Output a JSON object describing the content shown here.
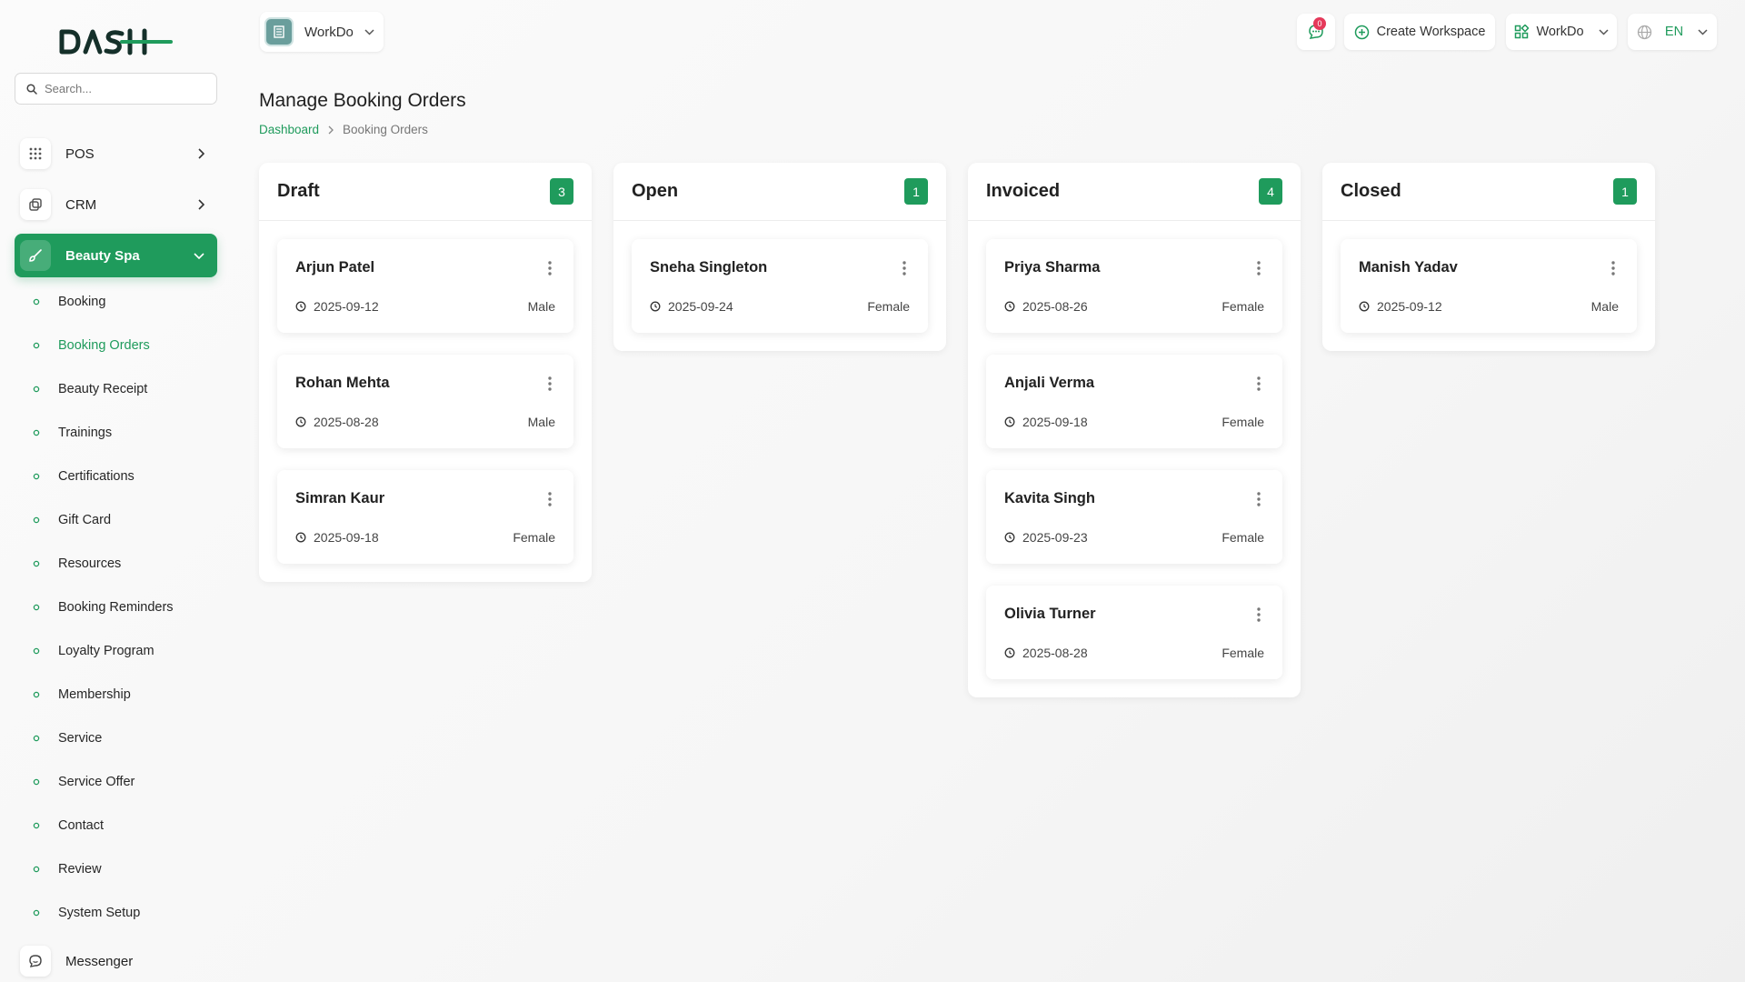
{
  "brand": {
    "logo_text": "DASH",
    "accent": "#1f9b5c"
  },
  "search": {
    "placeholder": "Search..."
  },
  "sidebar": {
    "menu": [
      {
        "label": "POS",
        "icon": "grid-icon"
      },
      {
        "label": "CRM",
        "icon": "layers-icon"
      },
      {
        "label": "Beauty Spa",
        "icon": "brush-icon",
        "active": true
      }
    ],
    "sub_items": [
      {
        "label": "Booking"
      },
      {
        "label": "Booking Orders",
        "active": true
      },
      {
        "label": "Beauty Receipt"
      },
      {
        "label": "Trainings"
      },
      {
        "label": "Certifications"
      },
      {
        "label": "Gift Card"
      },
      {
        "label": "Resources"
      },
      {
        "label": "Booking Reminders"
      },
      {
        "label": "Loyalty Program"
      },
      {
        "label": "Membership"
      },
      {
        "label": "Service"
      },
      {
        "label": "Service Offer"
      },
      {
        "label": "Contact"
      },
      {
        "label": "Review"
      },
      {
        "label": "System Setup"
      }
    ],
    "messenger": "Messenger"
  },
  "topbar": {
    "workspace_label": "WorkDo",
    "notification_count": "0",
    "create_workspace": "Create Workspace",
    "workspace_menu": "WorkDo",
    "language": "EN"
  },
  "page": {
    "title": "Manage Booking Orders",
    "breadcrumb_home": "Dashboard",
    "breadcrumb_current": "Booking Orders"
  },
  "columns": [
    {
      "title": "Draft",
      "count": "3",
      "cards": [
        {
          "name": "Arjun Patel",
          "date": "2025-09-12",
          "gender": "Male"
        },
        {
          "name": "Rohan Mehta",
          "date": "2025-08-28",
          "gender": "Male"
        },
        {
          "name": "Simran Kaur",
          "date": "2025-09-18",
          "gender": "Female"
        }
      ]
    },
    {
      "title": "Open",
      "count": "1",
      "cards": [
        {
          "name": "Sneha Singleton",
          "date": "2025-09-24",
          "gender": "Female"
        }
      ]
    },
    {
      "title": "Invoiced",
      "count": "4",
      "cards": [
        {
          "name": "Priya Sharma",
          "date": "2025-08-26",
          "gender": "Female"
        },
        {
          "name": "Anjali Verma",
          "date": "2025-09-18",
          "gender": "Female"
        },
        {
          "name": "Kavita Singh",
          "date": "2025-09-23",
          "gender": "Female"
        },
        {
          "name": "Olivia Turner",
          "date": "2025-08-28",
          "gender": "Female"
        }
      ]
    },
    {
      "title": "Closed",
      "count": "1",
      "cards": [
        {
          "name": "Manish Yadav",
          "date": "2025-09-12",
          "gender": "Male"
        }
      ]
    }
  ]
}
